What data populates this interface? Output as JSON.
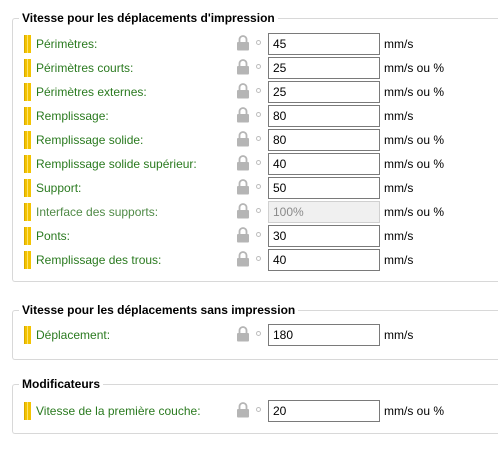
{
  "groups": [
    {
      "title": "Vitesse pour les déplacements d'impression",
      "rows": [
        {
          "label": "Périmètres:",
          "value": "45",
          "unit": "mm/s",
          "enabled": true
        },
        {
          "label": "Périmètres courts:",
          "value": "25",
          "unit": "mm/s ou %",
          "enabled": true
        },
        {
          "label": "Périmètres externes:",
          "value": "25",
          "unit": "mm/s ou %",
          "enabled": true
        },
        {
          "label": "Remplissage:",
          "value": "80",
          "unit": "mm/s",
          "enabled": true
        },
        {
          "label": "Remplissage solide:",
          "value": "80",
          "unit": "mm/s ou %",
          "enabled": true
        },
        {
          "label": "Remplissage solide supérieur:",
          "value": "40",
          "unit": "mm/s ou %",
          "enabled": true
        },
        {
          "label": "Support:",
          "value": "50",
          "unit": "mm/s",
          "enabled": true
        },
        {
          "label": "Interface des supports:",
          "value": "100%",
          "unit": "mm/s ou %",
          "enabled": false
        },
        {
          "label": "Ponts:",
          "value": "30",
          "unit": "mm/s",
          "enabled": true
        },
        {
          "label": "Remplissage des trous:",
          "value": "40",
          "unit": "mm/s",
          "enabled": true
        }
      ]
    },
    {
      "title": "Vitesse pour les déplacements sans impression",
      "rows": [
        {
          "label": "Déplacement:",
          "value": "180",
          "unit": "mm/s",
          "enabled": true
        }
      ]
    },
    {
      "title": "Modificateurs",
      "rows": [
        {
          "label": "Vitesse de la première couche:",
          "value": "20",
          "unit": "mm/s ou %",
          "enabled": true
        }
      ]
    }
  ],
  "icons": {
    "mode": "mode-indicator-icon",
    "lock": "lock-icon",
    "reset": "reset-dot-icon"
  },
  "colors": {
    "label": "#2a7a1f",
    "mode_indicator": "#f3c300",
    "lock": "#b5b5b5"
  }
}
